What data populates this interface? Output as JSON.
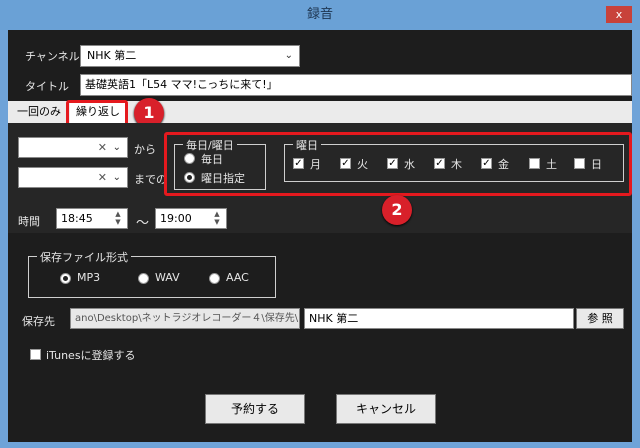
{
  "window": {
    "title": "録音",
    "close_label": "x"
  },
  "channel": {
    "label": "チャンネル",
    "value": "NHK 第二"
  },
  "title_field": {
    "label": "タイトル",
    "value": "基礎英語1「L54 ママ!こっちに来て!」"
  },
  "tabs": [
    {
      "label": "一回のみ"
    },
    {
      "label": "繰り返し"
    }
  ],
  "badges": {
    "one": "1",
    "two": "2"
  },
  "date_range": {
    "from_label": "から",
    "until_label": "までの",
    "clear_icon": "✕",
    "dropdown_icon": "⌄"
  },
  "schedule_mode": {
    "legend": "毎日/曜日",
    "options": [
      {
        "label": "毎日",
        "selected": false
      },
      {
        "label": "曜日指定",
        "selected": true
      }
    ]
  },
  "weekdays": {
    "legend": "曜日",
    "days": [
      {
        "label": "月",
        "checked": true
      },
      {
        "label": "火",
        "checked": true
      },
      {
        "label": "水",
        "checked": true
      },
      {
        "label": "木",
        "checked": true
      },
      {
        "label": "金",
        "checked": true
      },
      {
        "label": "土",
        "checked": false
      },
      {
        "label": "日",
        "checked": false
      }
    ]
  },
  "time": {
    "label": "時間",
    "start": "18:45",
    "separator": "～",
    "end": "19:00"
  },
  "format": {
    "legend": "保存ファイル形式",
    "options": [
      {
        "label": "MP3",
        "selected": true
      },
      {
        "label": "WAV",
        "selected": false
      },
      {
        "label": "AAC",
        "selected": false
      }
    ]
  },
  "save_to": {
    "label": "保存先",
    "path": "ano\\Desktop\\ネットラジオレコーダー４\\保存先\\",
    "folder": "NHK 第二",
    "browse_label": "参 照"
  },
  "itunes": {
    "label": "iTunesに登録する",
    "checked": false
  },
  "buttons": {
    "reserve": "予約する",
    "cancel": "キャンセル"
  },
  "colors": {
    "accent_red": "#e5191e",
    "titlebar": "#6aa1d6",
    "background": "#1d1d1d"
  }
}
